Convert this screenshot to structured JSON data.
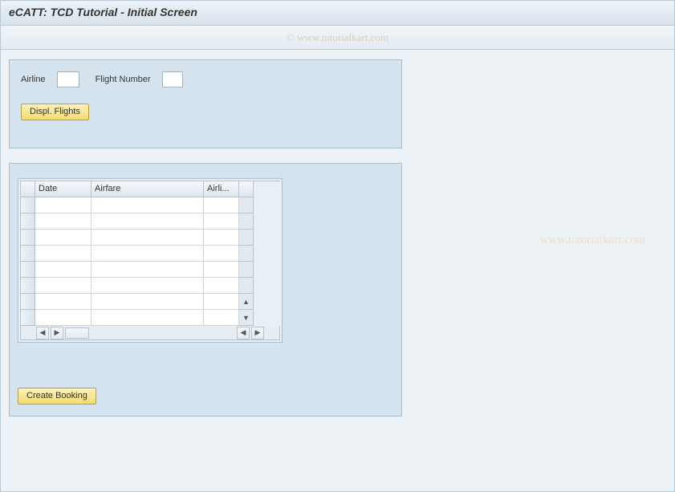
{
  "title": "eCATT: TCD Tutorial - Initial Screen",
  "watermark": "© www.tutorialkart.com",
  "watermark_side": "www.tutorialkart.com",
  "search_panel": {
    "airline_label": "Airline",
    "airline_value": "",
    "flight_label": "Flight Number",
    "flight_value": "",
    "display_button": "Displ. Flights"
  },
  "table": {
    "columns": [
      "Date",
      "Airfare",
      "Airli..."
    ],
    "rows": [
      [
        "",
        "",
        ""
      ],
      [
        "",
        "",
        ""
      ],
      [
        "",
        "",
        ""
      ],
      [
        "",
        "",
        ""
      ],
      [
        "",
        "",
        ""
      ],
      [
        "",
        "",
        ""
      ],
      [
        "",
        "",
        ""
      ],
      [
        "",
        "",
        ""
      ]
    ]
  },
  "booking_button": "Create Booking"
}
